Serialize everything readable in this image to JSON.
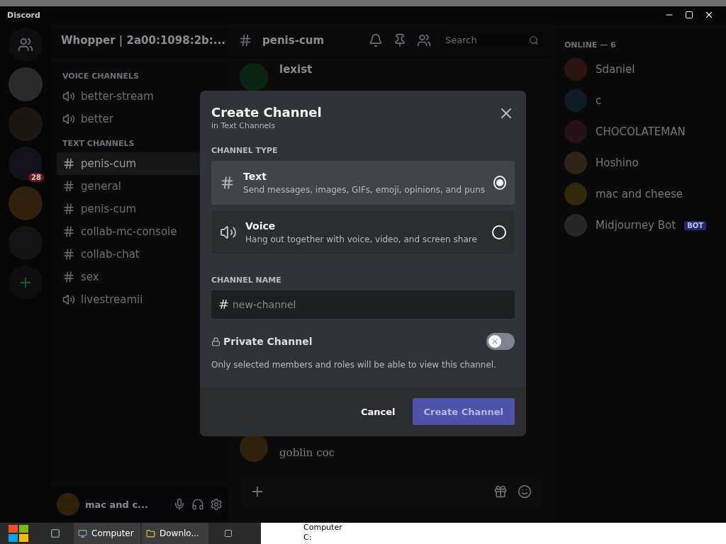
{
  "window": {
    "title": "Discord"
  },
  "server": {
    "name": "Whopper | 2a00:1098:2b:..."
  },
  "server_rail": [
    {
      "kind": "home"
    },
    {
      "kind": "server"
    },
    {
      "kind": "server"
    },
    {
      "kind": "server",
      "badge": "28"
    },
    {
      "kind": "server"
    },
    {
      "kind": "server"
    },
    {
      "kind": "add"
    }
  ],
  "sidebar": {
    "sections": [
      {
        "title": "VOICE CHANNELS",
        "channels": [
          {
            "kind": "voice",
            "name": "better-stream",
            "selected": false
          },
          {
            "kind": "voice",
            "name": "better",
            "selected": false
          }
        ]
      },
      {
        "title": "TEXT CHANNELS",
        "channels": [
          {
            "kind": "text",
            "name": "penis-cum",
            "selected": true
          },
          {
            "kind": "text",
            "name": "general",
            "selected": false
          },
          {
            "kind": "text",
            "name": "penis-cum",
            "selected": false
          },
          {
            "kind": "text",
            "name": "collab-mc-console",
            "selected": false
          },
          {
            "kind": "text",
            "name": "collab-chat",
            "selected": false
          },
          {
            "kind": "text",
            "name": "sex",
            "selected": false
          },
          {
            "kind": "voice",
            "name": "livestreamii",
            "selected": false
          }
        ]
      }
    ]
  },
  "user_panel": {
    "name": "mac and c..."
  },
  "chat": {
    "channel_name": "penis-cum",
    "search": {
      "placeholder": "Search"
    },
    "messages": [
      {
        "author": "lexist"
      },
      {
        "text": "goblin coc"
      }
    ]
  },
  "members": {
    "groups": [
      {
        "title": "ONLINE — 6",
        "items": [
          {
            "name": "Sdaniel"
          },
          {
            "name": "c"
          },
          {
            "name": "CHOCOLATEMAN"
          },
          {
            "name": "Hoshino"
          },
          {
            "name": "mac and cheese"
          },
          {
            "name": "Midjourney Bot",
            "tag": "BOT"
          }
        ]
      }
    ]
  },
  "modal": {
    "title": "Create Channel",
    "subtitle": "in Text Channels",
    "type_label": "CHANNEL TYPE",
    "options": [
      {
        "kind": "text",
        "title": "Text",
        "description": "Send messages, images, GIFs, emoji, opinions, and puns",
        "selected": true
      },
      {
        "kind": "voice",
        "title": "Voice",
        "description": "Hang out together with voice, video, and screen share",
        "selected": false
      }
    ],
    "name_label": "CHANNEL NAME",
    "name_field": {
      "prefix": "#",
      "placeholder": "new-channel"
    },
    "private": {
      "label": "Private Channel",
      "on": false,
      "description": "Only selected members and roles will be able to view this channel."
    },
    "buttons": [
      {
        "kind": "link",
        "label": "Cancel",
        "disabled": false
      },
      {
        "kind": "primary",
        "label": "Create Channel",
        "disabled": true
      }
    ]
  },
  "taskbar": {
    "items": [
      {
        "label": "Computer"
      },
      {
        "label": "Downlo..."
      }
    ]
  },
  "explorer": {
    "items": [
      "Computer",
      "C:"
    ]
  }
}
